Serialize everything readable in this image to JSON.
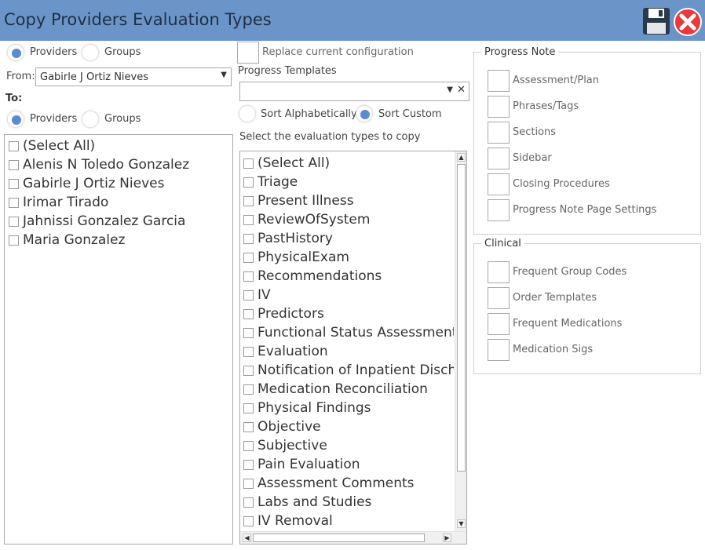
{
  "window": {
    "title": "Copy Providers Evaluation Types"
  },
  "source": {
    "radio_providers": "Providers",
    "radio_groups": "Groups",
    "from_label": "From:",
    "from_value": "Gabirle J Ortiz Nieves"
  },
  "target": {
    "to_label": "To:",
    "radio_providers": "Providers",
    "radio_groups": "Groups",
    "items": [
      "(Select All)",
      "Alenis N Toledo Gonzalez",
      "Gabirle J Ortiz Nieves",
      "Irimar Tirado",
      "Jahnissi Gonzalez Garcia",
      "Maria Gonzalez"
    ]
  },
  "middle": {
    "replace_label": "Replace current configuration",
    "templates_label": "Progress Templates",
    "templates_value": "",
    "sort_alpha": "Sort Alphabetically",
    "sort_custom": "Sort Custom",
    "select_label": "Select the evaluation types to copy",
    "types": [
      "(Select All)",
      "Triage",
      "Present Illness",
      "ReviewOfSystem",
      "PastHistory",
      "PhysicalExam",
      "Recommendations",
      "IV",
      "Predictors",
      "Functional Status Assessment",
      "Evaluation",
      "Notification of Inpatient Discha",
      "Medication Reconciliation",
      "Physical Findings",
      "Objective",
      "Subjective",
      "Pain Evaluation",
      "Assessment Comments",
      "Labs and Studies",
      "IV Removal"
    ]
  },
  "progress_note": {
    "legend": "Progress Note",
    "items": [
      "Assessment/Plan",
      "Phrases/Tags",
      "Sections",
      "Sidebar",
      "Closing Procedures",
      "Progress Note Page Settings"
    ]
  },
  "clinical": {
    "legend": "Clinical",
    "items": [
      "Frequent Group Codes",
      "Order Templates",
      "Frequent Medications",
      "Medication Sigs"
    ]
  },
  "icons": {
    "save": "floppy-disk-icon",
    "close": "close-icon"
  },
  "colors": {
    "titlebar": "#6b95c9",
    "radio_selected": "#5a8bd0",
    "close_red": "#e8393b"
  }
}
